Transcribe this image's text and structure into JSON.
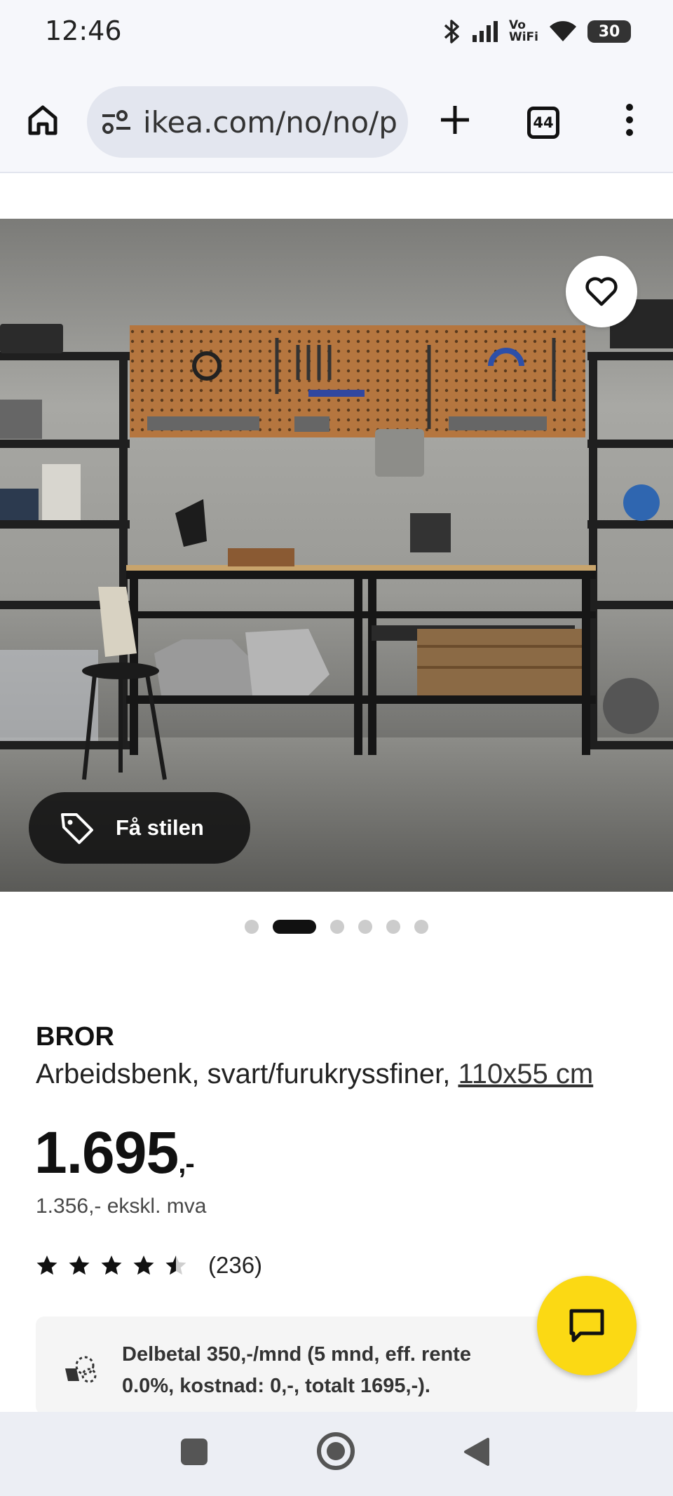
{
  "status_bar": {
    "time": "12:46",
    "network_label_top": "Vo",
    "network_label_bottom": "WiFi",
    "battery": "30",
    "icons": [
      "bluetooth-icon",
      "signal-icon",
      "vowifi-icon",
      "wifi-icon",
      "battery-icon"
    ]
  },
  "browser": {
    "url": "ikea.com/no/no/p",
    "tab_count": "44",
    "icons": [
      "home-icon",
      "tune-icon",
      "plus-icon",
      "tabs-icon",
      "more-vert-icon"
    ]
  },
  "gallery": {
    "style_button_label": "Få stilen",
    "dot_count": 6,
    "active_dot_index": 1,
    "icons": [
      "heart-icon",
      "tag-icon"
    ]
  },
  "product": {
    "brand": "BROR",
    "description": "Arbeidsbenk, svart/furukryssfiner, ",
    "size": "110x55 cm",
    "price": "1.695",
    "price_suffix": ",-",
    "price_ex_vat": "1.356,- ekskl. mva",
    "rating_value": 4.5,
    "rating_max": 5,
    "review_count": "(236)"
  },
  "installment": {
    "text": "Delbetal 350,-/mnd (5 mnd, eff. rente 0.0%, kostnad: 0,-, totalt 1695,-)."
  },
  "colors": {
    "accent_yellow": "#fbd914",
    "text_dark": "#111111",
    "card_bg": "#f5f5f5"
  }
}
